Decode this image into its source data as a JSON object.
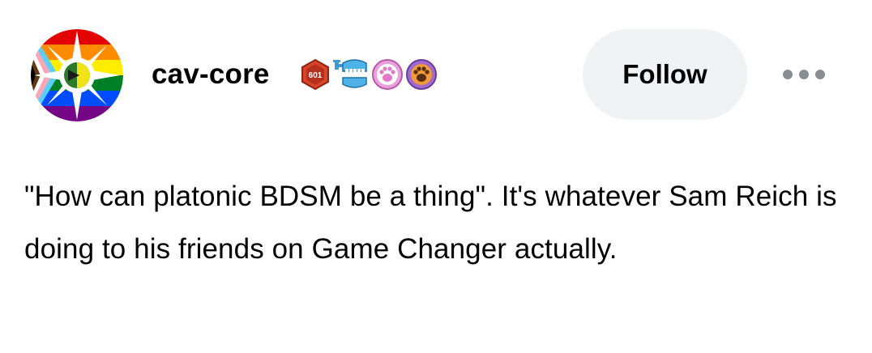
{
  "post": {
    "author": {
      "username": "cav-core",
      "avatar_icon": "pride-flag-sun-avatar-icon",
      "badges": [
        {
          "icon": "red-hexagon-counter-badge-icon",
          "label": "601",
          "color": "#d9452c"
        },
        {
          "icon": "wind-up-teeth-badge-icon",
          "color": "#3a9bd8"
        },
        {
          "icon": "pink-paw-badge-icon",
          "color": "#e47ac6"
        },
        {
          "icon": "orange-paw-badge-icon",
          "color": "#f09a3a"
        }
      ]
    },
    "follow_label": "Follow",
    "more_icon": "ellipsis-icon",
    "content": "\"How can platonic BDSM be a thing\". It's whatever Sam Reich is doing to his friends on Game Changer actually."
  },
  "colors": {
    "follow_bg": "#f0f2f4",
    "text": "#000000",
    "more_dots": "#8a8e93"
  }
}
